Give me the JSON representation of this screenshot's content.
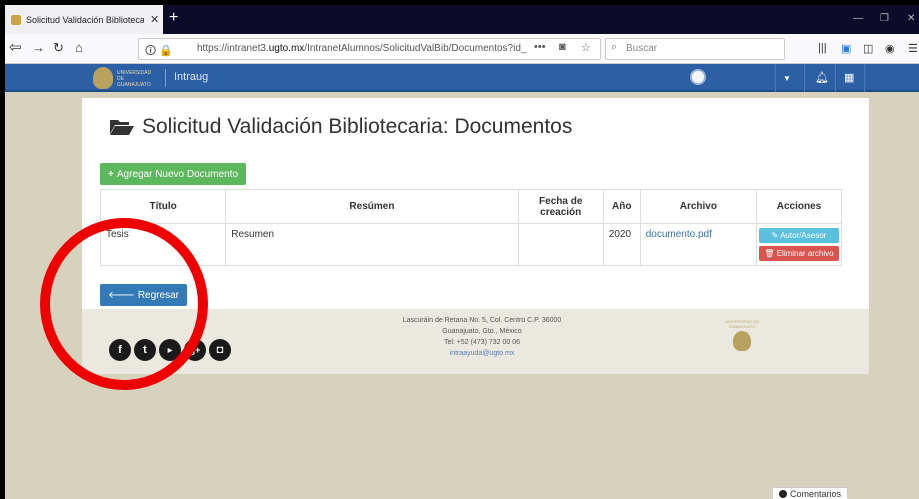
{
  "browser": {
    "tab_title": "Solicitud Validación Bibliotecari",
    "tab_close": "✕",
    "new_tab": "+",
    "url_prefix": "https://intranet3.",
    "url_domain": "ugto.mx",
    "url_path": "/IntranetAlumnos/SolicitudValBib/Documentos?id_soli",
    "url_more": "•••",
    "search_placeholder": "Buscar"
  },
  "app": {
    "logo_text": "UNIVERSIDAD DE GUANAJUATO",
    "name": "Intraug"
  },
  "page": {
    "title": "Solicitud Validación Bibliotecaria: Documentos",
    "add_button": "Agregar Nuevo Documento",
    "back_button": "Regresar"
  },
  "table": {
    "headers": [
      "Título",
      "Resúmen",
      "Fecha de creación",
      "Año",
      "Archivo",
      "Acciones"
    ],
    "rows": [
      {
        "titulo": "Tesis",
        "resumen": "Resumen",
        "fecha": "",
        "anio": "2020",
        "archivo": "documento.pdf",
        "action_autor": "Autor/Asesor",
        "action_eliminar": "Eliminar archivo"
      }
    ]
  },
  "footer": {
    "address_line1": "Lascuráin de Retana No. 5, Col. Centro C.P. 36000",
    "address_line2": "Guanajuato, Gto., México",
    "phone": "Tel: +52 (473) 732 00 06",
    "email": "intraayuda@ugto.mx",
    "logo_text": "UNIVERSIDAD DE GUANAJUATO",
    "social": [
      "facebook-icon",
      "twitter-icon",
      "youtube-icon",
      "google-plus-icon",
      "instagram-icon"
    ]
  },
  "comments_button": "Comentarios",
  "colors": {
    "header_blue": "#2c5fa3",
    "add_green": "#5cb85c",
    "back_blue": "#337ab7",
    "autor_cyan": "#5bc0de",
    "delete_red": "#d9534f",
    "annotation_red": "#ee0000"
  }
}
